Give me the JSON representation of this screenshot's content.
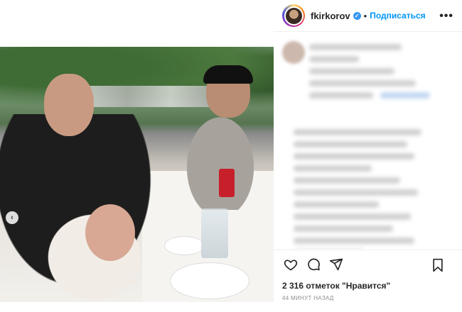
{
  "header": {
    "username": "fkirkorov",
    "separator": "•",
    "follow_label": "Подписаться",
    "more_label": "•••",
    "verified_mark": "✓"
  },
  "media": {
    "nav_prev_label": "‹"
  },
  "engagement": {
    "likes_text": "2 316 отметок \"Нравится\"",
    "time_text": "44 МИНУТ НАЗАД"
  },
  "icons": [
    "heart-icon",
    "comment-icon",
    "share-icon",
    "bookmark-icon",
    "verified-badge-icon",
    "more-icon",
    "chevron-left-icon"
  ],
  "colors": {
    "accent": "#0095f6",
    "verified": "#3897f0",
    "text": "#262626",
    "muted": "#8e8e8e"
  }
}
